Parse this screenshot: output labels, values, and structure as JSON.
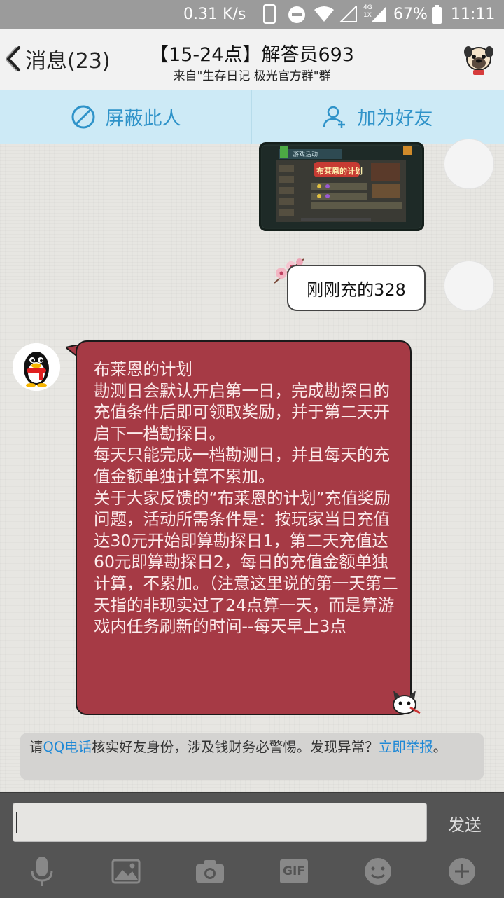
{
  "status_bar": {
    "speed": "0.31 K/s",
    "net_top": "4G",
    "net_bottom": "1X",
    "battery": "67%",
    "time": "11:11"
  },
  "header": {
    "back_label": "消息(23)",
    "title": "【15-24点】解答员693",
    "subtitle": "来自\"生存日记 极光官方群\"群"
  },
  "actions": {
    "block_label": "屏蔽此人",
    "add_friend_label": "加为好友"
  },
  "messages": {
    "sent_text": "刚刚充的328",
    "game_image": {
      "tab": "游戏活动",
      "banner": "布莱恩的计划"
    },
    "received_text": "布莱恩的计划\n勘测日会默认开启第一日，完成勘探日的充值条件后即可领取奖励，并于第二天开启下一档勘探日。\n每天只能完成一档勘测日，并且每天的充值金额单独计算不累加。\n关于大家反馈的“布莱恩的计划”充值奖励问题，活动所需条件是：按玩家当日充值达30元开始即算勘探日1，第二天充值达60元即算勘探日2，每日的充值金额单独计算，不累加。（注意这里说的第一天第二天指的非现实过了24点算一天，而是算游戏内任务刷新的时间--每天早上3点"
  },
  "notice": {
    "prefix": "请",
    "link1": "QQ电话",
    "middle": "核实好友身份，涉及钱财务必警惕。发现异常？",
    "link2": "立即举报",
    "suffix": "。"
  },
  "input": {
    "send_label": "发送",
    "gif_label": "GIF"
  },
  "colors": {
    "accent_blue": "#2f93c9",
    "bubble_red": "#a63a45",
    "link_blue": "#1e88d6"
  }
}
